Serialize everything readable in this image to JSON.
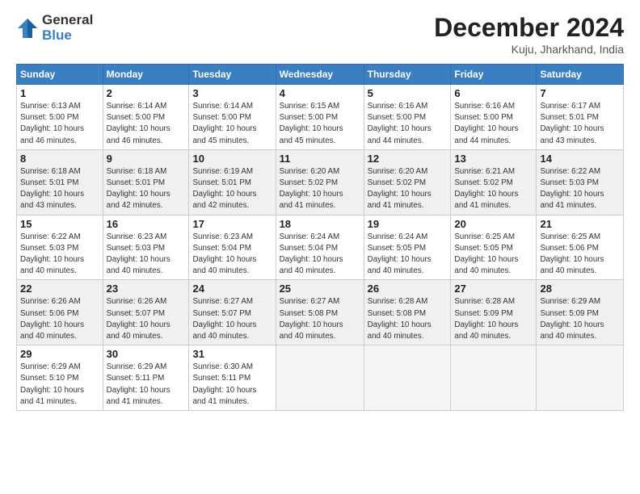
{
  "logo": {
    "general": "General",
    "blue": "Blue"
  },
  "title": "December 2024",
  "location": "Kuju, Jharkhand, India",
  "days_of_week": [
    "Sunday",
    "Monday",
    "Tuesday",
    "Wednesday",
    "Thursday",
    "Friday",
    "Saturday"
  ],
  "weeks": [
    [
      {
        "day": "1",
        "info": "Sunrise: 6:13 AM\nSunset: 5:00 PM\nDaylight: 10 hours\nand 46 minutes."
      },
      {
        "day": "2",
        "info": "Sunrise: 6:14 AM\nSunset: 5:00 PM\nDaylight: 10 hours\nand 46 minutes."
      },
      {
        "day": "3",
        "info": "Sunrise: 6:14 AM\nSunset: 5:00 PM\nDaylight: 10 hours\nand 45 minutes."
      },
      {
        "day": "4",
        "info": "Sunrise: 6:15 AM\nSunset: 5:00 PM\nDaylight: 10 hours\nand 45 minutes."
      },
      {
        "day": "5",
        "info": "Sunrise: 6:16 AM\nSunset: 5:00 PM\nDaylight: 10 hours\nand 44 minutes."
      },
      {
        "day": "6",
        "info": "Sunrise: 6:16 AM\nSunset: 5:00 PM\nDaylight: 10 hours\nand 44 minutes."
      },
      {
        "day": "7",
        "info": "Sunrise: 6:17 AM\nSunset: 5:01 PM\nDaylight: 10 hours\nand 43 minutes."
      }
    ],
    [
      {
        "day": "8",
        "info": "Sunrise: 6:18 AM\nSunset: 5:01 PM\nDaylight: 10 hours\nand 43 minutes."
      },
      {
        "day": "9",
        "info": "Sunrise: 6:18 AM\nSunset: 5:01 PM\nDaylight: 10 hours\nand 42 minutes."
      },
      {
        "day": "10",
        "info": "Sunrise: 6:19 AM\nSunset: 5:01 PM\nDaylight: 10 hours\nand 42 minutes."
      },
      {
        "day": "11",
        "info": "Sunrise: 6:20 AM\nSunset: 5:02 PM\nDaylight: 10 hours\nand 41 minutes."
      },
      {
        "day": "12",
        "info": "Sunrise: 6:20 AM\nSunset: 5:02 PM\nDaylight: 10 hours\nand 41 minutes."
      },
      {
        "day": "13",
        "info": "Sunrise: 6:21 AM\nSunset: 5:02 PM\nDaylight: 10 hours\nand 41 minutes."
      },
      {
        "day": "14",
        "info": "Sunrise: 6:22 AM\nSunset: 5:03 PM\nDaylight: 10 hours\nand 41 minutes."
      }
    ],
    [
      {
        "day": "15",
        "info": "Sunrise: 6:22 AM\nSunset: 5:03 PM\nDaylight: 10 hours\nand 40 minutes."
      },
      {
        "day": "16",
        "info": "Sunrise: 6:23 AM\nSunset: 5:03 PM\nDaylight: 10 hours\nand 40 minutes."
      },
      {
        "day": "17",
        "info": "Sunrise: 6:23 AM\nSunset: 5:04 PM\nDaylight: 10 hours\nand 40 minutes."
      },
      {
        "day": "18",
        "info": "Sunrise: 6:24 AM\nSunset: 5:04 PM\nDaylight: 10 hours\nand 40 minutes."
      },
      {
        "day": "19",
        "info": "Sunrise: 6:24 AM\nSunset: 5:05 PM\nDaylight: 10 hours\nand 40 minutes."
      },
      {
        "day": "20",
        "info": "Sunrise: 6:25 AM\nSunset: 5:05 PM\nDaylight: 10 hours\nand 40 minutes."
      },
      {
        "day": "21",
        "info": "Sunrise: 6:25 AM\nSunset: 5:06 PM\nDaylight: 10 hours\nand 40 minutes."
      }
    ],
    [
      {
        "day": "22",
        "info": "Sunrise: 6:26 AM\nSunset: 5:06 PM\nDaylight: 10 hours\nand 40 minutes."
      },
      {
        "day": "23",
        "info": "Sunrise: 6:26 AM\nSunset: 5:07 PM\nDaylight: 10 hours\nand 40 minutes."
      },
      {
        "day": "24",
        "info": "Sunrise: 6:27 AM\nSunset: 5:07 PM\nDaylight: 10 hours\nand 40 minutes."
      },
      {
        "day": "25",
        "info": "Sunrise: 6:27 AM\nSunset: 5:08 PM\nDaylight: 10 hours\nand 40 minutes."
      },
      {
        "day": "26",
        "info": "Sunrise: 6:28 AM\nSunset: 5:08 PM\nDaylight: 10 hours\nand 40 minutes."
      },
      {
        "day": "27",
        "info": "Sunrise: 6:28 AM\nSunset: 5:09 PM\nDaylight: 10 hours\nand 40 minutes."
      },
      {
        "day": "28",
        "info": "Sunrise: 6:29 AM\nSunset: 5:09 PM\nDaylight: 10 hours\nand 40 minutes."
      }
    ],
    [
      {
        "day": "29",
        "info": "Sunrise: 6:29 AM\nSunset: 5:10 PM\nDaylight: 10 hours\nand 41 minutes."
      },
      {
        "day": "30",
        "info": "Sunrise: 6:29 AM\nSunset: 5:11 PM\nDaylight: 10 hours\nand 41 minutes."
      },
      {
        "day": "31",
        "info": "Sunrise: 6:30 AM\nSunset: 5:11 PM\nDaylight: 10 hours\nand 41 minutes."
      },
      {
        "day": "",
        "info": ""
      },
      {
        "day": "",
        "info": ""
      },
      {
        "day": "",
        "info": ""
      },
      {
        "day": "",
        "info": ""
      }
    ]
  ]
}
